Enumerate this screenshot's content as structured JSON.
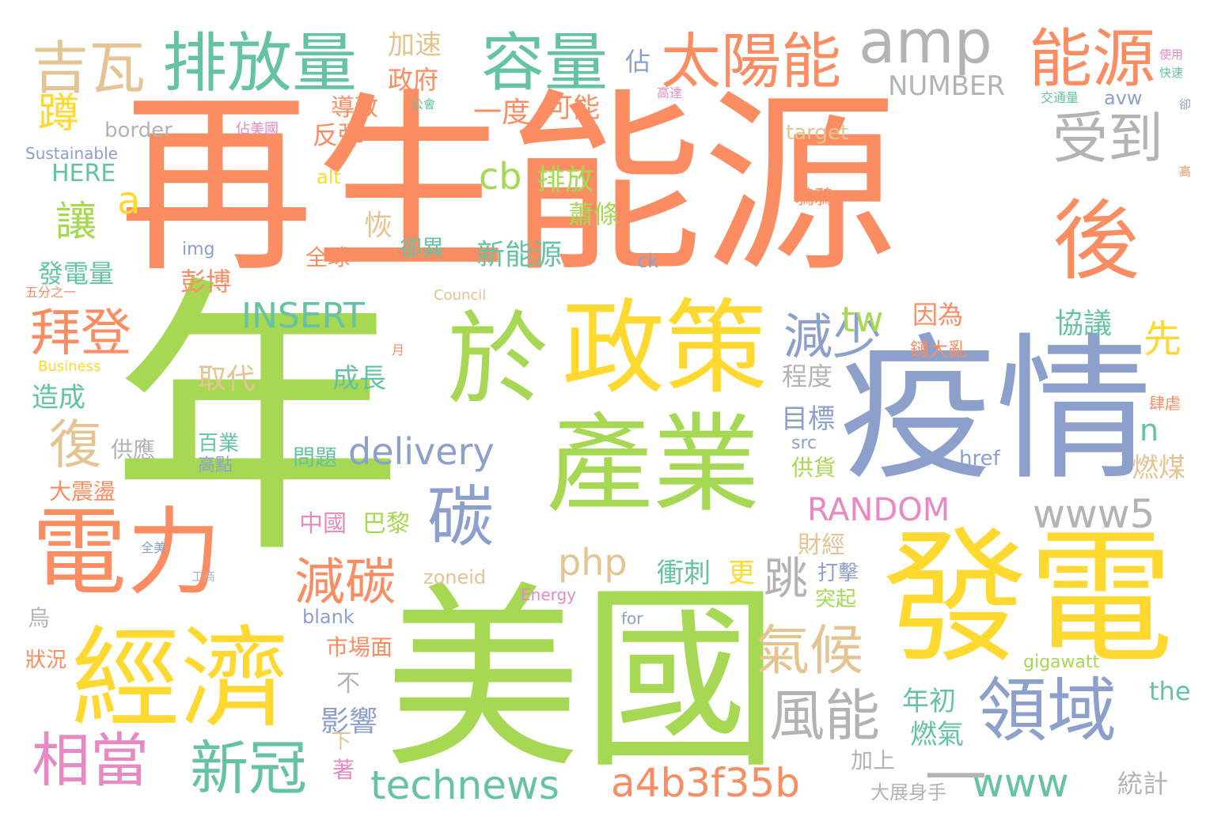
{
  "palette": {
    "orange": "#fc8d62",
    "green": "#a6d854",
    "yellow": "#ffd92f",
    "blue": "#8da0cb",
    "teal": "#66c2a5",
    "tan": "#e5c494",
    "gray": "#b3b3b3",
    "pink": "#e78ac3"
  },
  "words": [
    {
      "text": "再生能源",
      "color": "#fc8d62"
    },
    {
      "text": "年",
      "color": "#a6d854"
    },
    {
      "text": "美國",
      "color": "#a6d854"
    },
    {
      "text": "疫情",
      "color": "#8da0cb"
    },
    {
      "text": "發電",
      "color": "#ffd92f"
    },
    {
      "text": "政策",
      "color": "#ffd92f"
    },
    {
      "text": "於",
      "color": "#a6d854"
    },
    {
      "text": "產業",
      "color": "#a6d854"
    },
    {
      "text": "經濟",
      "color": "#ffd92f"
    },
    {
      "text": "電力",
      "color": "#fc8d62"
    },
    {
      "text": "後",
      "color": "#fc8d62"
    },
    {
      "text": "排放量",
      "color": "#66c2a5"
    },
    {
      "text": "容量",
      "color": "#66c2a5"
    },
    {
      "text": "太陽能",
      "color": "#fc8d62"
    },
    {
      "text": "amp",
      "color": "#b3b3b3"
    },
    {
      "text": "能源",
      "color": "#fc8d62"
    },
    {
      "text": "吉瓦",
      "color": "#e5c494"
    },
    {
      "text": "受到",
      "color": "#b3b3b3"
    },
    {
      "text": "領域",
      "color": "#8da0cb"
    },
    {
      "text": "相當",
      "color": "#e78ac3"
    },
    {
      "text": "新冠",
      "color": "#66c2a5"
    },
    {
      "text": "technews",
      "color": "#66c2a5"
    },
    {
      "text": "a4b3f35b",
      "color": "#fc8d62"
    },
    {
      "text": "www",
      "color": "#66c2a5"
    },
    {
      "text": "風能",
      "color": "#b3b3b3"
    },
    {
      "text": "氣候",
      "color": "#e5c494"
    },
    {
      "text": "減碳",
      "color": "#fc8d62"
    },
    {
      "text": "碳",
      "color": "#8da0cb"
    },
    {
      "text": "拜登",
      "color": "#fc8d62"
    },
    {
      "text": "減少",
      "color": "#8da0cb"
    },
    {
      "text": "www5",
      "color": "#b3b3b3"
    },
    {
      "text": "RANDOM",
      "color": "#e78ac3"
    },
    {
      "text": "delivery",
      "color": "#8da0cb"
    },
    {
      "text": "INSERT",
      "color": "#66c2a5"
    },
    {
      "text": "php",
      "color": "#e5c494"
    },
    {
      "text": "復",
      "color": "#e5c494"
    },
    {
      "text": "cb",
      "color": "#a6d854"
    },
    {
      "text": "排放",
      "color": "#a6d854"
    },
    {
      "text": "讓",
      "color": "#a6d854"
    },
    {
      "text": "蹲",
      "color": "#ffd92f"
    },
    {
      "text": "a",
      "color": "#ffd92f"
    },
    {
      "text": "tw",
      "color": "#a6d854"
    },
    {
      "text": "先",
      "color": "#ffd92f"
    },
    {
      "text": "n",
      "color": "#66c2a5"
    },
    {
      "text": "跳",
      "color": "#b3b3b3"
    },
    {
      "text": "NUMBER",
      "color": "#b3b3b3"
    },
    {
      "text": "一度",
      "color": "#fc8d62"
    },
    {
      "text": "可能",
      "color": "#fc8d62"
    },
    {
      "text": "加速",
      "color": "#e5c494"
    },
    {
      "text": "政府",
      "color": "#fc8d62"
    },
    {
      "text": "佔",
      "color": "#8da0cb"
    },
    {
      "text": "border",
      "color": "#b3b3b3"
    },
    {
      "text": "反彈",
      "color": "#fc8d62"
    },
    {
      "text": "導致",
      "color": "#fc8d62"
    },
    {
      "text": "HERE",
      "color": "#66c2a5"
    },
    {
      "text": "Sustainable",
      "color": "#8da0cb"
    },
    {
      "text": "佔美國",
      "color": "#e78ac3"
    },
    {
      "text": "公會",
      "color": "#66c2a5"
    },
    {
      "text": "高達",
      "color": "#e78ac3"
    },
    {
      "text": "四成",
      "color": "#fc8d62"
    },
    {
      "text": "交通量",
      "color": "#66c2a5"
    },
    {
      "text": "avw",
      "color": "#8da0cb"
    },
    {
      "text": "target",
      "color": "#e5c494"
    },
    {
      "text": "恢",
      "color": "#e5c494"
    },
    {
      "text": "新能源",
      "color": "#66c2a5"
    },
    {
      "text": "蕭條",
      "color": "#a6d854"
    },
    {
      "text": "鴉鴉",
      "color": "#fc8d62"
    },
    {
      "text": "全球",
      "color": "#fc8d62"
    },
    {
      "text": "卻異",
      "color": "#66c2a5"
    },
    {
      "text": "彭博",
      "color": "#fc8d62"
    },
    {
      "text": "發電量",
      "color": "#66c2a5"
    },
    {
      "text": "img",
      "color": "#8da0cb"
    },
    {
      "text": "ck",
      "color": "#8da0cb"
    },
    {
      "text": "alt",
      "color": "#ffd92f"
    },
    {
      "text": "因為",
      "color": "#fc8d62"
    },
    {
      "text": "協議",
      "color": "#66c2a5"
    },
    {
      "text": "程度",
      "color": "#b3b3b3"
    },
    {
      "text": "成長",
      "color": "#66c2a5"
    },
    {
      "text": "取代",
      "color": "#e5c494"
    },
    {
      "text": "造成",
      "color": "#66c2a5"
    },
    {
      "text": "目標",
      "color": "#8da0cb"
    },
    {
      "text": "鏈大亂",
      "color": "#fc8d62"
    },
    {
      "text": "供應",
      "color": "#b3b3b3"
    },
    {
      "text": "百業",
      "color": "#66c2a5"
    },
    {
      "text": "問題",
      "color": "#66c2a5"
    },
    {
      "text": "高點",
      "color": "#8da0cb"
    },
    {
      "text": "燃煤",
      "color": "#e5c494"
    },
    {
      "text": "供貨",
      "color": "#a6d854"
    },
    {
      "text": "src",
      "color": "#8da0cb"
    },
    {
      "text": "href",
      "color": "#8da0cb"
    },
    {
      "text": "大震盪",
      "color": "#fc8d62"
    },
    {
      "text": "中國",
      "color": "#e78ac3"
    },
    {
      "text": "巴黎",
      "color": "#a6d854"
    },
    {
      "text": "財經",
      "color": "#e5c494"
    },
    {
      "text": "衝刺",
      "color": "#66c2a5"
    },
    {
      "text": "更",
      "color": "#ffd92f"
    },
    {
      "text": "打擊",
      "color": "#8da0cb"
    },
    {
      "text": "突起",
      "color": "#a6d854"
    },
    {
      "text": "zoneid",
      "color": "#e5c494"
    },
    {
      "text": "blank",
      "color": "#8da0cb"
    },
    {
      "text": "Energy",
      "color": "#e78ac3"
    },
    {
      "text": "for",
      "color": "#8da0cb"
    },
    {
      "text": "市場面",
      "color": "#fc8d62"
    },
    {
      "text": "年初",
      "color": "#66c2a5"
    },
    {
      "text": "燃氣",
      "color": "#66c2a5"
    },
    {
      "text": "影響",
      "color": "#8da0cb"
    },
    {
      "text": "加上",
      "color": "#b3b3b3"
    },
    {
      "text": "大展身手",
      "color": "#b3b3b3"
    },
    {
      "text": "統計",
      "color": "#b3b3b3"
    },
    {
      "text": "the",
      "color": "#66c2a5"
    },
    {
      "text": "gigawatt",
      "color": "#a6d854"
    },
    {
      "text": "不",
      "color": "#b3b3b3"
    },
    {
      "text": "下",
      "color": "#e5c494"
    },
    {
      "text": "著",
      "color": "#e78ac3"
    },
    {
      "text": "烏",
      "color": "#b3b3b3"
    },
    {
      "text": "狀況",
      "color": "#fc8d62"
    },
    {
      "text": "Council",
      "color": "#e5c494"
    },
    {
      "text": "Business",
      "color": "#ffd92f"
    },
    {
      "text": "五分之一",
      "color": "#fc8d62"
    },
    {
      "text": "使用",
      "color": "#e78ac3"
    },
    {
      "text": "快速",
      "color": "#66c2a5"
    },
    {
      "text": "卻",
      "color": "#8da0cb"
    },
    {
      "text": "高",
      "color": "#fc8d62"
    },
    {
      "text": "肆虐",
      "color": "#fc8d62"
    },
    {
      "text": "月",
      "color": "#fc8d62"
    },
    {
      "text": "全美",
      "color": "#8da0cb"
    },
    {
      "text": "工商",
      "color": "#b3b3b3"
    },
    {
      "text": "—",
      "color": "#b3b3b3"
    }
  ]
}
